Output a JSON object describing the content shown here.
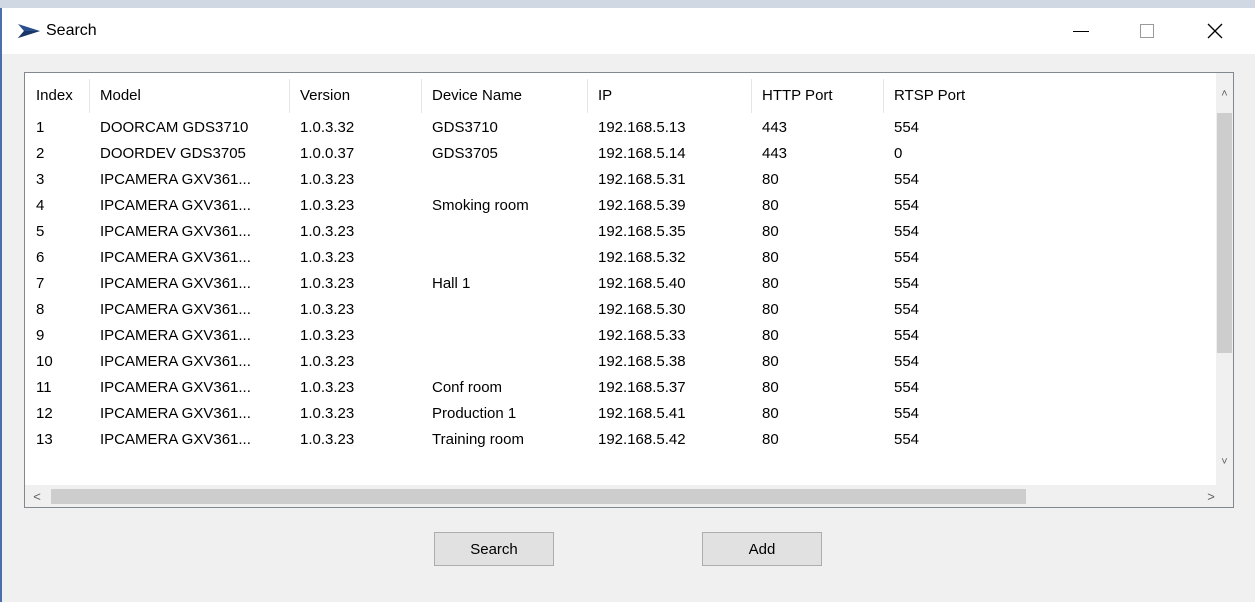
{
  "window": {
    "title": "Search",
    "minimize_glyph": "—",
    "close_glyph": "✕"
  },
  "table": {
    "columns": [
      "Index",
      "Model",
      "Version",
      "Device Name",
      "IP",
      "HTTP Port",
      "RTSP Port"
    ],
    "rows": [
      [
        "1",
        "DOORCAM  GDS3710",
        "1.0.3.32",
        "GDS3710",
        "192.168.5.13",
        "443",
        "554"
      ],
      [
        "2",
        "DOORDEV  GDS3705",
        "1.0.0.37",
        "GDS3705",
        "192.168.5.14",
        "443",
        "0"
      ],
      [
        "3",
        "IPCAMERA GXV361...",
        "1.0.3.23",
        "",
        "192.168.5.31",
        "80",
        "554"
      ],
      [
        "4",
        "IPCAMERA GXV361...",
        "1.0.3.23",
        "Smoking room",
        "192.168.5.39",
        "80",
        "554"
      ],
      [
        "5",
        "IPCAMERA GXV361...",
        "1.0.3.23",
        "",
        "192.168.5.35",
        "80",
        "554"
      ],
      [
        "6",
        "IPCAMERA GXV361...",
        "1.0.3.23",
        "",
        "192.168.5.32",
        "80",
        "554"
      ],
      [
        "7",
        "IPCAMERA GXV361...",
        "1.0.3.23",
        "Hall 1",
        "192.168.5.40",
        "80",
        "554"
      ],
      [
        "8",
        "IPCAMERA GXV361...",
        "1.0.3.23",
        "",
        "192.168.5.30",
        "80",
        "554"
      ],
      [
        "9",
        "IPCAMERA GXV361...",
        "1.0.3.23",
        "",
        "192.168.5.33",
        "80",
        "554"
      ],
      [
        "10",
        "IPCAMERA GXV361...",
        "1.0.3.23",
        "",
        "192.168.5.38",
        "80",
        "554"
      ],
      [
        "11",
        "IPCAMERA GXV361...",
        "1.0.3.23",
        "Conf room",
        "192.168.5.37",
        "80",
        "554"
      ],
      [
        "12",
        "IPCAMERA GXV361...",
        "1.0.3.23",
        "Production 1",
        "192.168.5.41",
        "80",
        "554"
      ],
      [
        "13",
        "IPCAMERA GXV361...",
        "1.0.3.23",
        "Training room",
        "192.168.5.42",
        "80",
        "554"
      ]
    ]
  },
  "scroll": {
    "up": "˄",
    "down": "˅",
    "left": "<",
    "right": ">"
  },
  "buttons": {
    "search": "Search",
    "add": "Add"
  },
  "colors": {
    "window_border": "#4b6fa8",
    "icon_blue": "#2a4f8f"
  }
}
